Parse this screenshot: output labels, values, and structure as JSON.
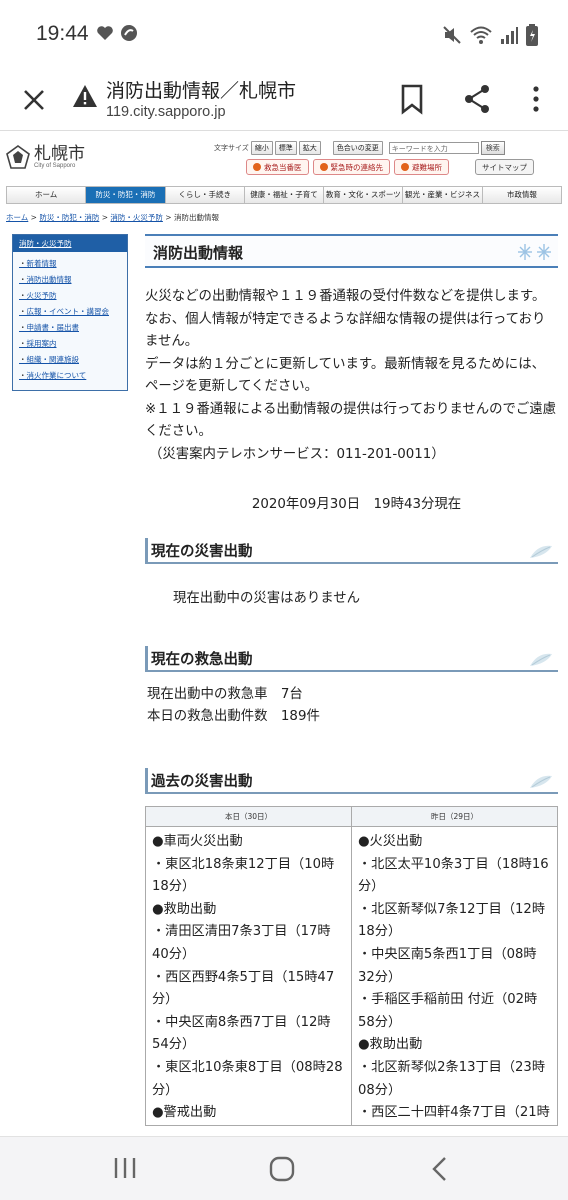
{
  "status": {
    "time": "19:44"
  },
  "browser": {
    "title": "消防出動情報／札幌市",
    "url": "119.city.sapporo.jp"
  },
  "site": {
    "logo_text": "札幌市",
    "logo_sub": "City of Sapporo",
    "font_size_label": "文字サイズ",
    "font_small": "縮小",
    "font_std": "標準",
    "font_large": "拡大",
    "color_change": "色合いの変更",
    "search_placeholder": "キーワードを入力",
    "search_button": "検索",
    "quick1": "救急当番医",
    "quick2": "緊急時の連絡先",
    "quick3": "避難場所",
    "sitemap": "サイトマップ",
    "gnav": [
      "ホーム",
      "防災・防犯・消防",
      "くらし・手続き",
      "健康・福祉・子育て",
      "教育・文化・スポーツ",
      "観光・産業・ビジネス",
      "市政情報"
    ],
    "breadcrumb": [
      "ホーム",
      "防災・防犯・消防",
      "消防・火災予防",
      "消防出動情報"
    ]
  },
  "sidebar": {
    "heading": "消防・火災予防",
    "items": [
      "新着情報",
      "消防出動情報",
      "火災予防",
      "広報・イベント・講習会",
      "申請書・届出書",
      "採用案内",
      "組織・関連施設",
      "消火作業について"
    ]
  },
  "main": {
    "title": "消防出動情報",
    "intro": [
      "火災などの出動情報や１１９番通報の受付件数などを提供します。",
      "なお、個人情報が特定できるような詳細な情報の提供は行っておりません。",
      "データは約１分ごとに更新しています。最新情報を見るためには、ページを更新してください。",
      "※１１９番通報による出動情報の提供は行っておりませんのでご遠慮ください。",
      "（災害案内テレホンサービス：011-201-0011）"
    ],
    "datetime": "2020年09月30日　19時43分現在",
    "current_disaster": {
      "heading": "現在の災害出動",
      "message": "現在出動中の災害はありません"
    },
    "current_ems": {
      "heading": "現在の救急出動",
      "line1": "現在出動中の救急車　7台",
      "line2": "本日の救急出動件数　189件"
    },
    "past": {
      "heading": "過去の災害出動",
      "today_label": "本日（30日）",
      "yesterday_label": "昨日（29日）",
      "today": [
        "●車両火災出動",
        "・東区北18条東12丁目（10時18分）",
        "●救助出動",
        "・清田区清田7条3丁目（17時40分）",
        "・西区西野4条5丁目（15時47分）",
        "・中央区南8条西7丁目（12時54分）",
        "・東区北10条東8丁目（08時28分）",
        "●警戒出動"
      ],
      "yesterday": [
        "●火災出動",
        "・北区太平10条3丁目（18時16分）",
        "・北区新琴似7条12丁目（12時18分）",
        "・中央区南5条西1丁目（08時32分）",
        "・手稲区手稲前田 付近（02時58分）",
        "●救助出動",
        "・北区新琴似2条13丁目（23時08分）",
        "・西区二十四軒4条7丁目（21時"
      ]
    }
  }
}
